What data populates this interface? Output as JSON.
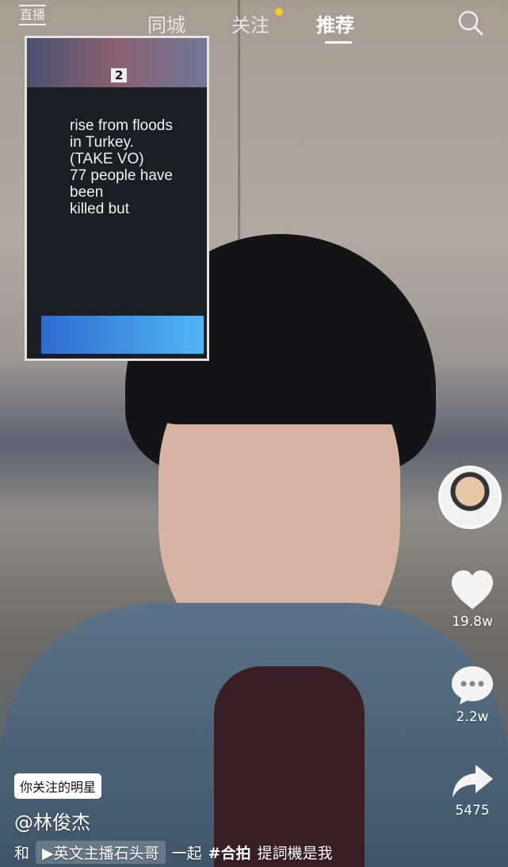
{
  "nav": {
    "live": "直播",
    "tabs": [
      "同城",
      "关注",
      "推荐"
    ],
    "active_tab": "推荐",
    "follow_dot_color": "#f8cc1a",
    "search_icon": "search-icon"
  },
  "inset": {
    "number": "2",
    "prompt_lines": [
      "rise from floods",
      "in Turkey.",
      "(TAKE VO)",
      "77 people have",
      "been",
      "killed   but"
    ]
  },
  "side": {
    "like_count": "19.8w",
    "comment_count": "2.2w",
    "share_count": "5475"
  },
  "caption": {
    "badge": "你关注的明星",
    "username": "@林俊杰",
    "with": "和",
    "duet_partner": "英文主播石头哥",
    "together": "一起",
    "hashtag": "#合拍",
    "text": "提詞機是我"
  }
}
